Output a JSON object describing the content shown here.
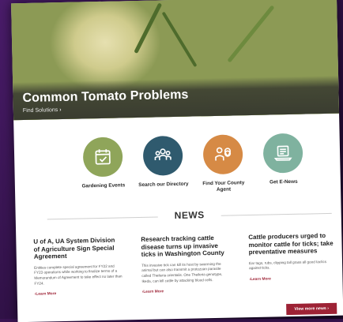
{
  "hero": {
    "title": "Common Tomato Problems",
    "link_label": "Find Solutions",
    "link_chevron": "›"
  },
  "quick_links": [
    {
      "label": "Gardening Events",
      "icon": "calendar-check-icon",
      "color": "#8fa55a"
    },
    {
      "label": "Search our Directory",
      "icon": "people-icon",
      "color": "#2f5a6e"
    },
    {
      "label": "Find Your County Agent",
      "icon": "person-location-icon",
      "color": "#d68a45"
    },
    {
      "label": "Get E-News",
      "icon": "laptop-news-icon",
      "color": "#7fb29f"
    }
  ],
  "news": {
    "heading": "NEWS",
    "articles": [
      {
        "title": "U of A, UA System Division of Agriculture Sign Special Agreement",
        "summary": "Entities complete special agreement for FY22 and FY23 operations while working to finalize terms of a Memorandum of Agreement to take effect no later than FY24.",
        "more_label": "Learn More"
      },
      {
        "title": "Research tracking cattle disease turns up invasive ticks in Washington County",
        "summary": "This invasive tick can kill its host by swarming the animal but can also transmit a protozoan parasite called Theileria orientalis. One Theileria genotype, Ikeda, can kill cattle by attacking blood cells.",
        "more_label": "Learn More"
      },
      {
        "title": "Cattle producers urged to monitor cattle for ticks; take preventative measures",
        "summary": "Ear tags, rubs, clipping tall grass all good tactics against ticks.",
        "more_label": "Learn More"
      }
    ],
    "view_more_label": "View more news",
    "more_prefix": "›",
    "view_more_chevron": "›"
  },
  "colors": {
    "accent": "#9d2235",
    "background_frame": "#3a1552"
  }
}
